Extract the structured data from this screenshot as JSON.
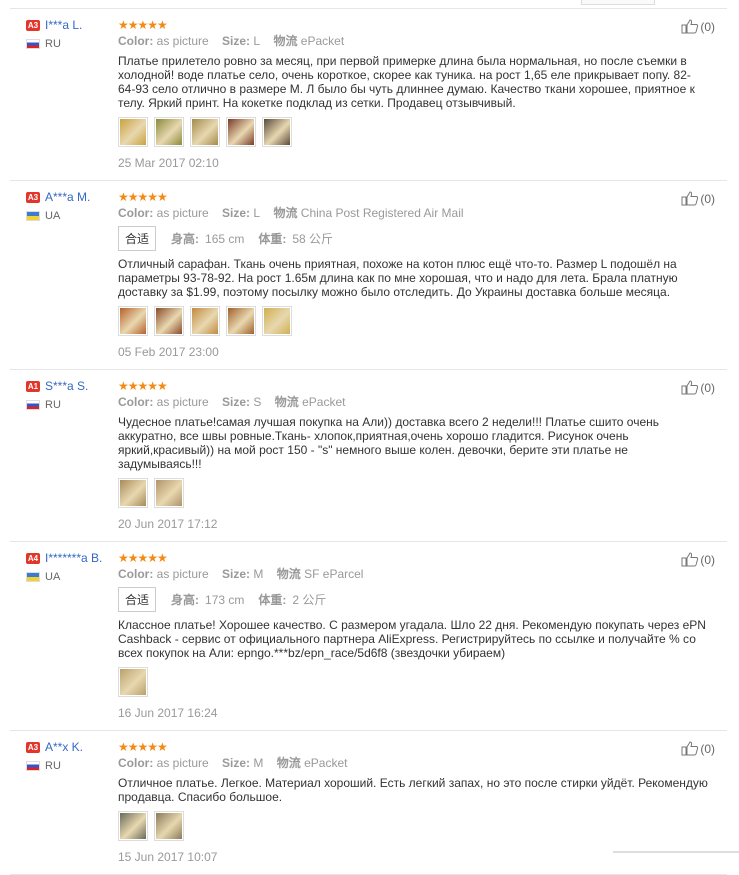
{
  "labels": {
    "color": "Color:",
    "size": "Size:",
    "logistics": "物流",
    "fit_box": "合适",
    "height": "身高:",
    "weight": "体重:"
  },
  "colors": {
    "link": "#3469c5",
    "star": "#f38a13",
    "level_badge": "#e2362b",
    "muted": "#999999"
  },
  "reviews": [
    {
      "level": "A3",
      "user": "I***a L.",
      "country": "RU",
      "flag": "ru",
      "stars": "★★★★★",
      "color_value": "as picture",
      "size_value": "L",
      "shipping": "ePacket",
      "text": "Платье прилетело ровно за месяц, при первой примерке длина была нормальная, но после съемки в холодной! воде платье село, очень короткое, скорее как туника. на рост 1,65 еле прикрывает попу. 82-64-93 село отлично в размере М. Л было бы чуть длиннее думаю. Качество ткани хорошее, приятное к телу. Яркий принт. На кокетке подклад из сетки. Продавец отзывчивый.",
      "photos": [
        "#c9a23e",
        "#8a8a3a",
        "#a28a4a",
        "#7a3a2a",
        "#5a4a3a"
      ],
      "date": "25 Mar 2017 02:10",
      "useful": "(0)"
    },
    {
      "level": "A3",
      "user": "A***a M.",
      "country": "UA",
      "flag": "ua",
      "stars": "★★★★★",
      "color_value": "as picture",
      "size_value": "L",
      "shipping": "China Post Registered Air Mail",
      "height_value": "165 cm",
      "weight_value": "58 公斤",
      "text": "Отличный сарафан. Ткань очень приятная, похоже на котон плюс ещё что-то. Размер L подошёл на параметры 93-78-92. На рост 1.65м длина как по мне хорошая, что и надо для лета. Брала платную доставку за $1.99, поэтому посылку можно было отследить. До Украины доставка больше месяца.",
      "photos": [
        "#b8602a",
        "#8a4a2a",
        "#c08a40",
        "#a0602a",
        "#d0b050"
      ],
      "date": "05 Feb 2017 23:00",
      "useful": "(0)"
    },
    {
      "level": "A1",
      "user": "S***a S.",
      "country": "RU",
      "flag": "ru",
      "stars": "★★★★★",
      "color_value": "as picture",
      "size_value": "S",
      "shipping": "ePacket",
      "text": "Чудесное платье!самая лучшая покупка на Али)) доставка всего 2 недели!!! Платье сшито очень аккуратно, все швы ровные.Ткань- хлопок,приятная,очень хорошо гладится. Рисунок очень яркий,красивый)) на мой рост 150 - \"s\" немного выше колен. девочки, берите эти платье не задумываясь!!!",
      "photos": [
        "#a88a5a",
        "#b0926a"
      ],
      "date": "20 Jun 2017 17:12",
      "useful": "(0)"
    },
    {
      "level": "A4",
      "user": "I*******a B.",
      "country": "UA",
      "flag": "ua",
      "stars": "★★★★★",
      "color_value": "as picture",
      "size_value": "M",
      "shipping": "SF eParcel",
      "height_value": "173 cm",
      "weight_value": "2 公斤",
      "text": "Классное платье! Хорошее качество. С размером угадала. Шло 22 дня. Рекомендую покупать через ePN Cashback - сервис от официального партнера AliExpress. Регистрируйтесь по ссылке и получайте % со всех покупок на Али: epngo.***bz/epn_race/5d6f8 (звездочки убираем)",
      "photos": [
        "#b8a06a"
      ],
      "date": "16 Jun 2017 16:24",
      "useful": "(0)"
    },
    {
      "level": "A3",
      "user": "A**x K.",
      "country": "RU",
      "flag": "ru",
      "stars": "★★★★★",
      "color_value": "as picture",
      "size_value": "M",
      "shipping": "ePacket",
      "text": "Отличное платье. Легкое. Материал хороший. Есть легкий запах, но это после стирки уйдёт. Рекомендую продавца. Спасибо большое.",
      "photos": [
        "#6a6a5a",
        "#8a7a5a"
      ],
      "date": "15 Jun 2017 10:07",
      "useful": "(0)"
    }
  ]
}
